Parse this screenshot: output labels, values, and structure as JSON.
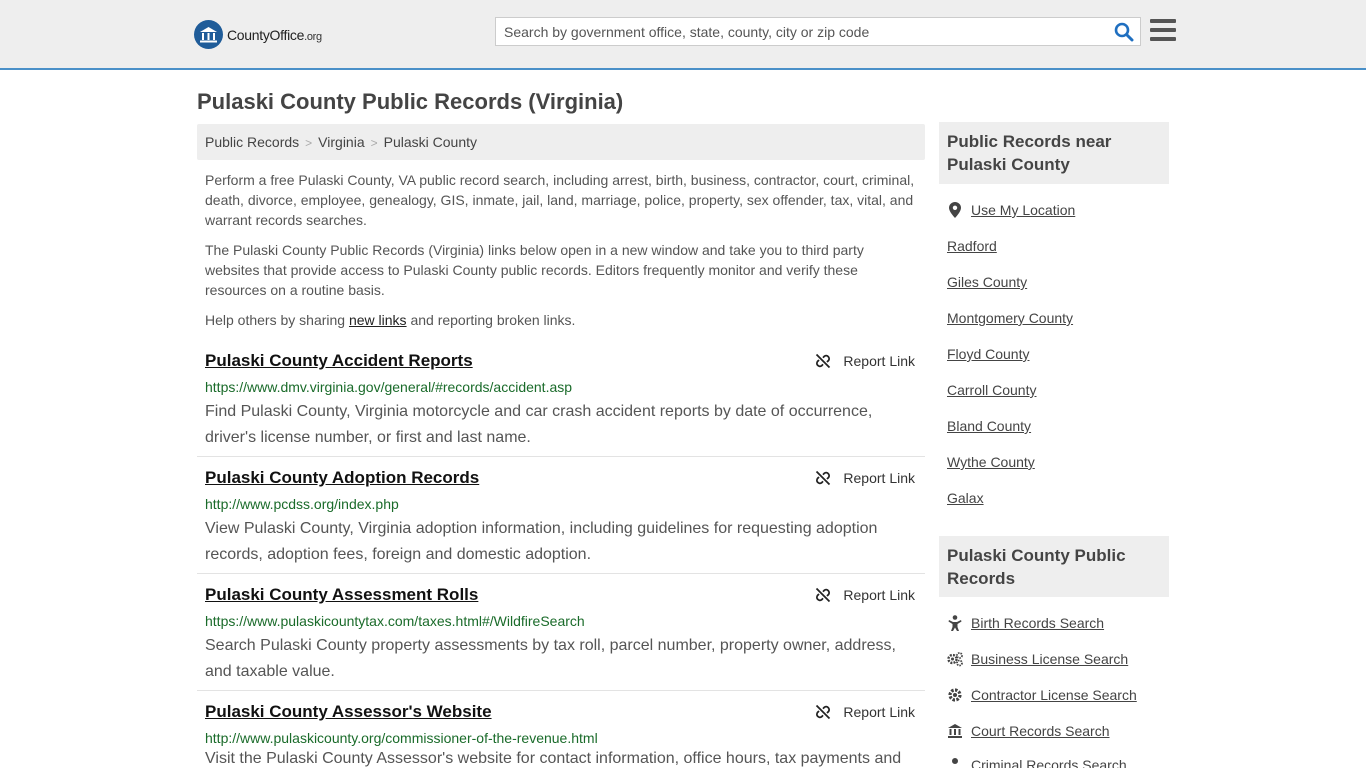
{
  "header": {
    "logo_text": "CountyOffice",
    "logo_org": ".org",
    "search_placeholder": "Search by government office, state, county, city or zip code"
  },
  "page_title": "Pulaski County Public Records (Virginia)",
  "breadcrumb": [
    "Public Records",
    "Virginia",
    "Pulaski County"
  ],
  "intro": {
    "p1": "Perform a free Pulaski County, VA public record search, including arrest, birth, business, contractor, court, criminal, death, divorce, employee, genealogy, GIS, inmate, jail, land, marriage, police, property, sex offender, tax, vital, and warrant records searches.",
    "p2": "The Pulaski County Public Records (Virginia) links below open in a new window and take you to third party websites that provide access to Pulaski County public records. Editors frequently monitor and verify these resources on a routine basis.",
    "p3_before": "Help others by sharing ",
    "p3_link": "new links",
    "p3_after": " and reporting broken links."
  },
  "report_label": "Report Link",
  "records": [
    {
      "title": "Pulaski County Accident Reports",
      "url": "https://www.dmv.virginia.gov/general/#records/accident.asp",
      "desc": "Find Pulaski County, Virginia motorcycle and car crash accident reports by date of occurrence, driver's license number, or first and last name."
    },
    {
      "title": "Pulaski County Adoption Records",
      "url": "http://www.pcdss.org/index.php",
      "desc": "View Pulaski County, Virginia adoption information, including guidelines for requesting adoption records, adoption fees, foreign and domestic adoption."
    },
    {
      "title": "Pulaski County Assessment Rolls",
      "url": "https://www.pulaskicountytax.com/taxes.html#/WildfireSearch",
      "desc": "Search Pulaski County property assessments by tax roll, parcel number, property owner, address, and taxable value."
    },
    {
      "title": "Pulaski County Assessor's Website",
      "url": "http://www.pulaskicounty.org/commissioner-of-the-revenue.html",
      "desc": "Visit the Pulaski County Assessor's website for contact information, office hours, tax payments and"
    }
  ],
  "sidebar": {
    "near_heading": "Public Records near Pulaski County",
    "use_location": "Use My Location",
    "near_links": [
      "Radford",
      "Giles County",
      "Montgomery County",
      "Floyd County",
      "Carroll County",
      "Bland County",
      "Wythe County",
      "Galax"
    ],
    "records_heading": "Pulaski County Public Records",
    "record_links": [
      {
        "label": "Birth Records Search",
        "icon": "baby-icon"
      },
      {
        "label": "Business License Search",
        "icon": "gears-icon"
      },
      {
        "label": "Contractor License Search",
        "icon": "gear-icon"
      },
      {
        "label": "Court Records Search",
        "icon": "courthouse-icon"
      },
      {
        "label": "Criminal Records Search",
        "icon": "criminal-icon"
      }
    ]
  },
  "colors": {
    "header_bg": "#eeeeee",
    "header_border": "#4a90c8",
    "url_green": "#1a6b2a",
    "search_icon": "#1f6fc0"
  }
}
